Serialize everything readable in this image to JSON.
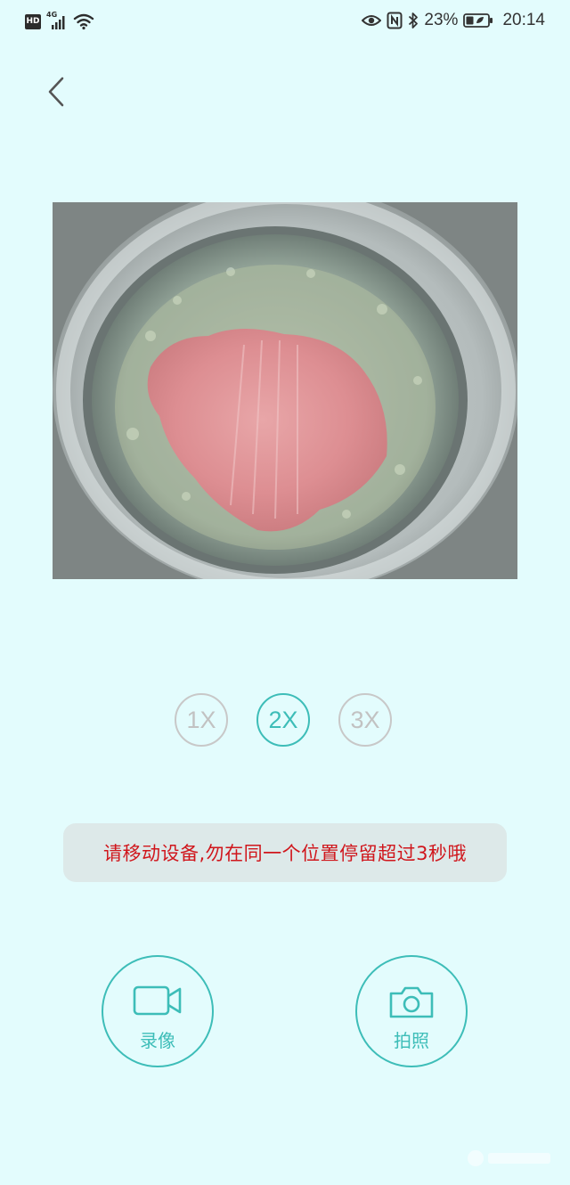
{
  "status_bar": {
    "hd_badge": "HD",
    "network": "4G",
    "battery_percent": "23%",
    "time": "20:14",
    "icons": [
      "hd-icon",
      "signal-icon",
      "wifi-icon",
      "eye-icon",
      "nfc-icon",
      "bluetooth-icon",
      "battery-icon"
    ]
  },
  "navigation": {
    "back_icon": "chevron-left-icon"
  },
  "camera_preview": {
    "description_icon": "camera-feed"
  },
  "zoom": {
    "options": [
      "1X",
      "2X",
      "3X"
    ],
    "selected": "2X",
    "active_color": "#3dbdb8",
    "inactive_color": "#c2c2c2"
  },
  "hint": {
    "text": "请移动设备,勿在同一个位置停留超过3秒哦",
    "color": "#d0161c"
  },
  "actions": {
    "record_label": "录像",
    "photo_label": "拍照",
    "record_icon": "video-camera-icon",
    "photo_icon": "camera-icon"
  },
  "colors": {
    "background": "#e3fcfd",
    "accent": "#3dbdb8"
  }
}
